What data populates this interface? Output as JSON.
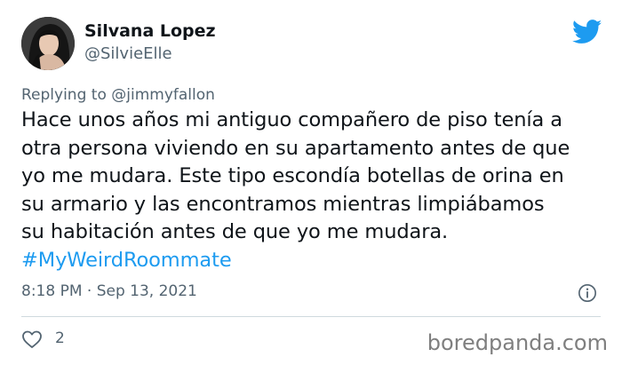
{
  "author": {
    "name": "Silvana Lopez",
    "handle": "@SilvieElle"
  },
  "reply": {
    "prefix": "Replying to",
    "mention": "@jimmyfallon"
  },
  "tweet": {
    "lines": [
      "Hace unos años mi antiguo compañero de piso tenía a",
      "otra persona viviendo en su apartamento antes de que",
      "yo me mudara. Este tipo escondía botellas de orina en",
      "su armario y las encontramos mientras limpiábamos",
      "su habitación antes de que yo me mudara."
    ],
    "hashtag": "#MyWeirdRoommate"
  },
  "meta": {
    "timestamp": "8:18 PM · Sep 13, 2021"
  },
  "actions": {
    "likes": "2"
  },
  "watermark": "boredpanda.com",
  "icons": {
    "logo": "twitter-bird-icon",
    "info": "info-icon",
    "like": "heart-icon"
  },
  "colors": {
    "brand": "#1d9bf0",
    "text": "#0f1419",
    "secondary": "#536471"
  }
}
